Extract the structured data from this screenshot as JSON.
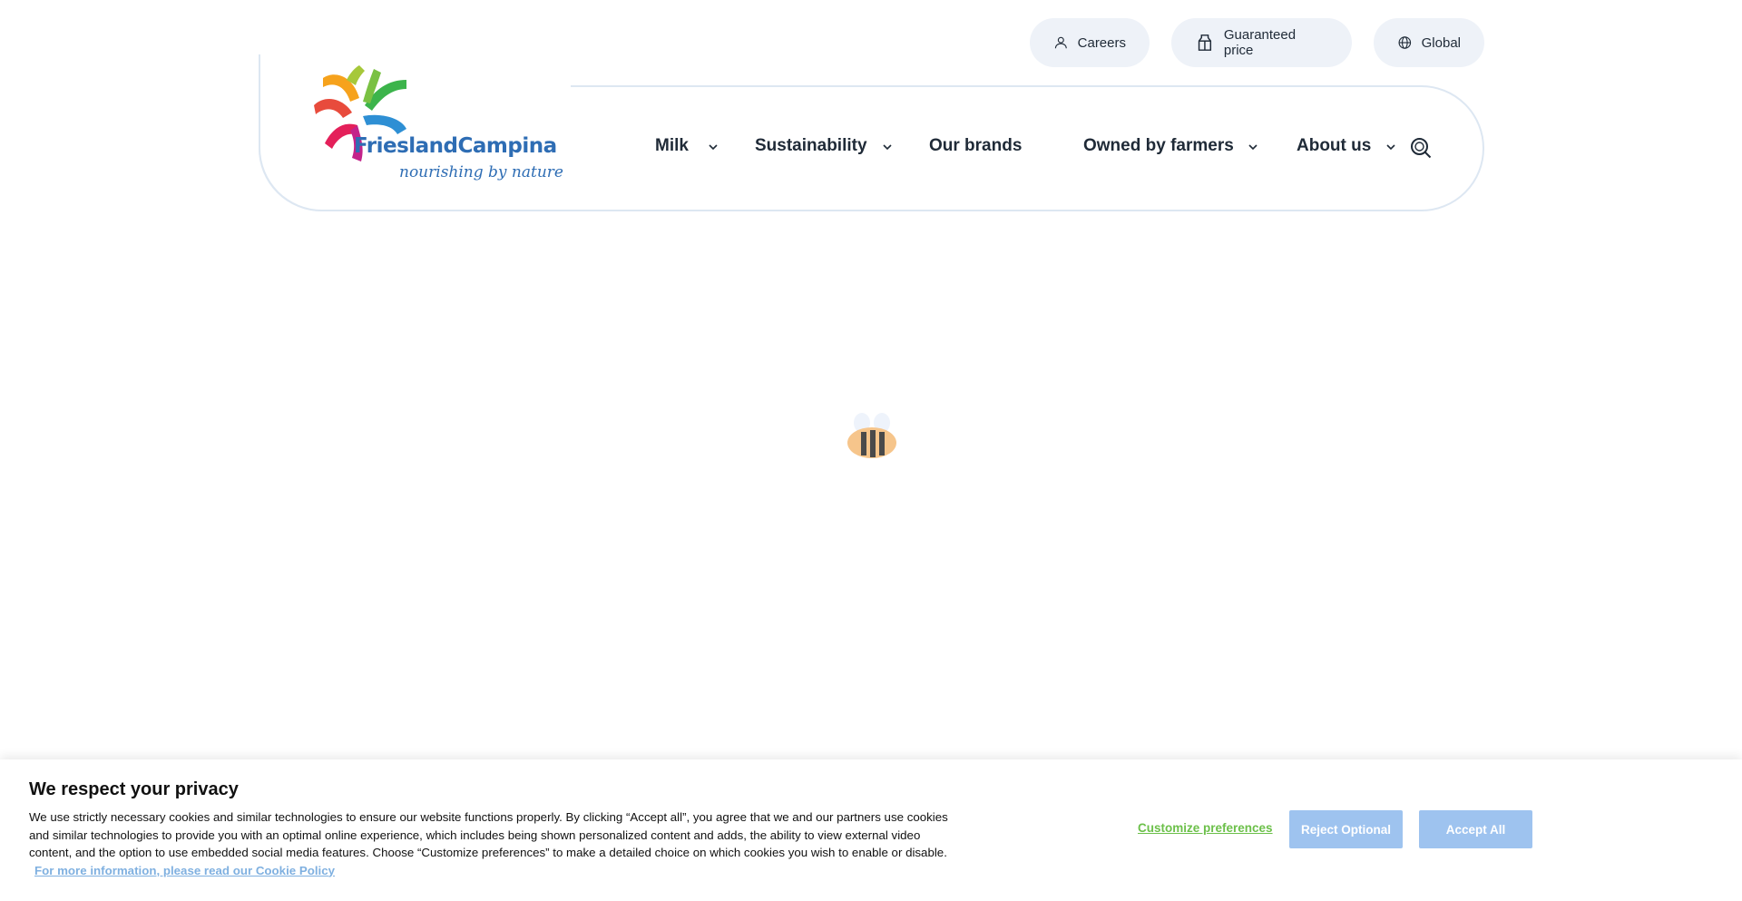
{
  "utility": {
    "careers": "Careers",
    "guaranteed_price": "Guaranteed price",
    "global": "Global"
  },
  "logo": {
    "brand": "FrieslandCampina",
    "tagline": "nourishing by nature"
  },
  "nav": {
    "milk": "Milk",
    "sustainability": "Sustainability",
    "brands": "Our brands",
    "owned": "Owned by farmers",
    "about": "About us"
  },
  "cookie": {
    "title": "We respect your privacy",
    "body": "We use strictly necessary cookies and similar technologies to ensure our website functions properly. By clicking “Accept all”, you agree that we and our partners use cookies and similar technologies to provide you with an optimal online experience, which includes being shown personalized content and adds, the ability to view external video content, and the option to use embedded social media features. Choose “Customize preferences” to make a detailed choice on which cookies you wish to enable or disable.",
    "link": "For more information, please read our Cookie Policy",
    "customize": "Customize preferences",
    "reject": "Reject Optional",
    "accept": "Accept All"
  },
  "colors": {
    "brand_blue": "#2e6db4",
    "pill_bg": "#eef2f8",
    "button_bg": "#9ec3ef",
    "customize_green": "#6cc04a"
  }
}
